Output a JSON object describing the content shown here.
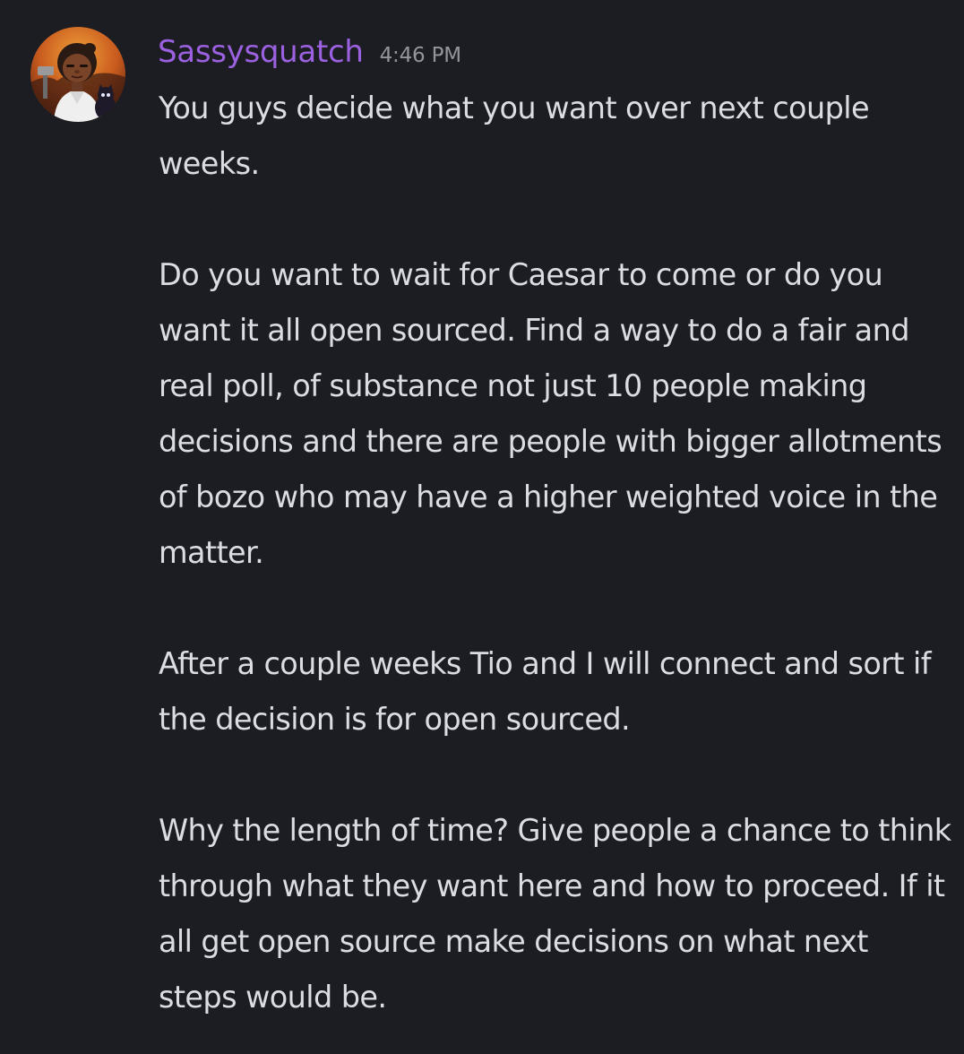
{
  "message": {
    "author": "Sassysquatch",
    "timestamp": "4:46 PM",
    "avatar_icon": "cartoon-character-avatar-icon",
    "paragraphs": [
      "You guys decide what you want over next couple weeks.",
      "Do you want to wait for Caesar to come or do you want it all open sourced. Find a way to do a fair and real poll, of substance not just 10 people making decisions and there are people with bigger allotments of bozo who may have a higher weighted voice in the matter.",
      "After a couple weeks Tio and I will connect and sort if the decision is for open sourced.",
      "Why the length of time? Give people a chance to think through what they want here and how to proceed. If it all get open source make decisions on what next steps would be."
    ]
  },
  "colors": {
    "background": "#1c1d22",
    "username": "#9b61e0",
    "timestamp": "#93959d",
    "text": "#dcdde2"
  }
}
